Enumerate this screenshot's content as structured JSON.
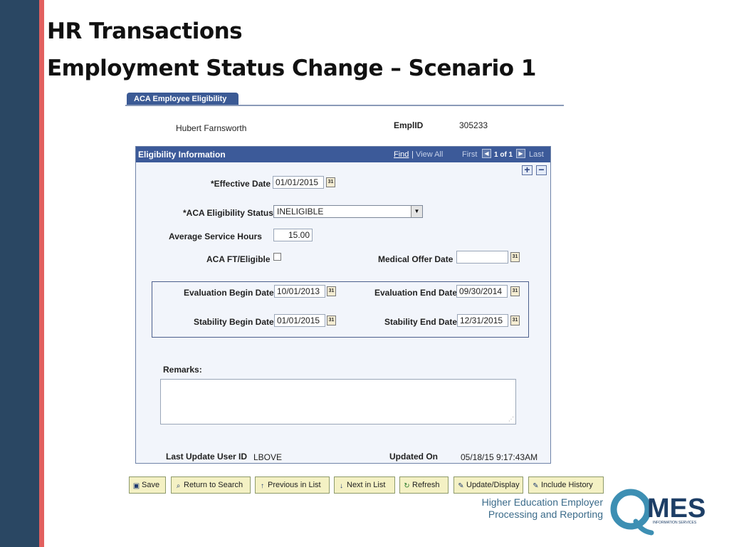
{
  "slide": {
    "title_line1": "HR Transactions",
    "title_line2": "Employment Status Change – Scenario 1"
  },
  "page": {
    "tab_label": "ACA Employee Eligibility",
    "employee_name": "Hubert Farnsworth",
    "emplid_label": "EmplID",
    "emplid_value": "305233"
  },
  "panel": {
    "title": "Eligibility Information",
    "nav": {
      "find": "Find",
      "separator": "|",
      "view_all": "View All",
      "first": "First",
      "count": "1 of 1",
      "last": "Last"
    },
    "fields": {
      "effective_date_label": "*Effective Date",
      "effective_date_value": "01/01/2015",
      "aca_status_label": "*ACA Eligibility Status",
      "aca_status_value": "INELIGIBLE",
      "avg_hours_label": "Average Service Hours",
      "avg_hours_value": "15.00",
      "aca_ft_label": "ACA FT/Eligible",
      "aca_ft_checked": false,
      "medical_offer_label": "Medical Offer Date",
      "medical_offer_value": "",
      "eval_begin_label": "Evaluation Begin Date",
      "eval_begin_value": "10/01/2013",
      "eval_end_label": "Evaluation End Date",
      "eval_end_value": "09/30/2014",
      "stab_begin_label": "Stability Begin Date",
      "stab_begin_value": "01/01/2015",
      "stab_end_label": "Stability End Date",
      "stab_end_value": "12/31/2015",
      "remarks_label": "Remarks:",
      "remarks_value": ""
    },
    "footer": {
      "last_update_label": "Last Update User ID",
      "last_update_value": "LBOVE",
      "updated_on_label": "Updated On",
      "updated_on_value": "05/18/15  9:17:43AM"
    }
  },
  "toolbar": {
    "save": "Save",
    "return_to_search": "Return to Search",
    "previous_in_list": "Previous in List",
    "next_in_list": "Next in List",
    "refresh": "Refresh",
    "update_display": "Update/Display",
    "include_history": "Include History"
  },
  "footer": {
    "line1": "Higher Education Employer",
    "line2": "Processing and Reporting",
    "logo_text": "MES",
    "logo_sub": "INFORMATION SERVICES"
  },
  "colors": {
    "sidebar": "#2a4763",
    "accent_stripe": "#e2605f",
    "panel_header": "#3c5a99",
    "toolbar_button": "#f4f1c4"
  }
}
